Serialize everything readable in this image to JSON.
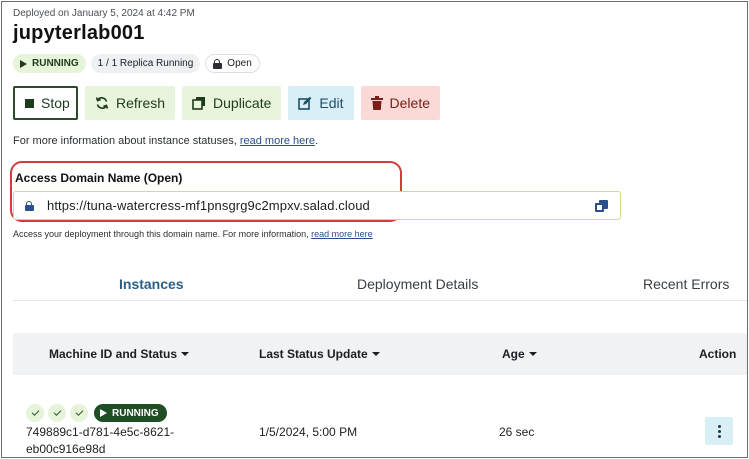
{
  "header": {
    "deployed_on": "Deployed on January 5, 2024 at 4:42 PM",
    "title": "jupyterlab001"
  },
  "badges": {
    "running": "RUNNING",
    "replicas": "1 / 1 Replica Running",
    "open": "Open"
  },
  "toolbar": {
    "stop": "Stop",
    "refresh": "Refresh",
    "duplicate": "Duplicate",
    "edit": "Edit",
    "delete": "Delete"
  },
  "status_info": {
    "text": "For more information about instance statuses, ",
    "link": "read more here",
    "suffix": "."
  },
  "access_domain": {
    "label": "Access Domain Name (Open)",
    "url": "https://tuna-watercress-mf1pnsgrg9c2mpxv.salad.cloud",
    "hint": "Access your deployment through this domain name. For more information, ",
    "hint_link": "read more here"
  },
  "tabs": [
    "Instances",
    "Deployment Details",
    "Recent Errors"
  ],
  "table": {
    "columns": [
      "Machine ID and Status",
      "Last Status Update",
      "Age",
      "Action"
    ],
    "rows": [
      {
        "status": "RUNNING",
        "machine_id": "749889c1-d781-4e5c-8621-eb00c916e98d",
        "last_update": "1/5/2024, 5:00 PM",
        "age": "26 sec"
      }
    ]
  },
  "colors": {
    "accent_green": "#1f4d24",
    "link_blue": "#2a4f8a",
    "callout_red": "#d63a3a"
  },
  "icons": [
    "play-icon",
    "lock-icon",
    "stop-icon",
    "refresh-icon",
    "duplicate-icon",
    "edit-icon",
    "trash-icon",
    "copy-icon",
    "check-icon",
    "kebab-menu-icon"
  ]
}
